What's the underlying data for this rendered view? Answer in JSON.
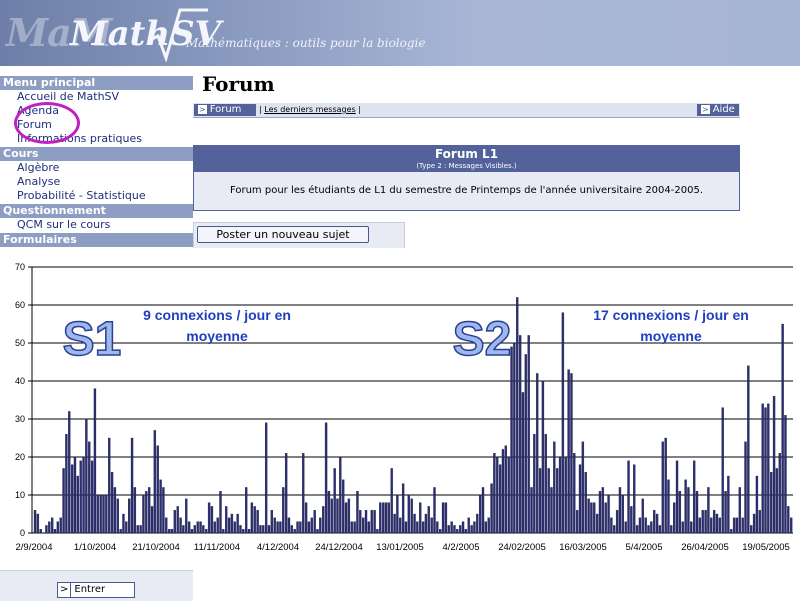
{
  "banner": {
    "ghost_text": "MaM",
    "logo": "MathSV",
    "tagline": "Mathématiques : outils pour la biologie"
  },
  "sidebar": {
    "sections": [
      {
        "title": "Menu principal",
        "items": [
          "Accueil de MathSV",
          "Agenda",
          "Forum",
          "Informations pratiques"
        ]
      },
      {
        "title": "Cours",
        "items": [
          "Algèbre",
          "Analyse",
          "Probabilité - Statistique"
        ]
      },
      {
        "title": "Questionnement",
        "items": [
          "QCM sur le cours"
        ]
      },
      {
        "title": "Formulaires",
        "items": []
      }
    ]
  },
  "forum": {
    "title": "Forum",
    "tab_forum": "Forum",
    "latest_messages": "Les derniers messages",
    "tab_help": "Aide",
    "box_title": "Forum L1",
    "box_subtitle": "(Type 2 : Messages Visibles.)",
    "box_description": "Forum pour les étudiants de L1 du semestre de Printemps de l'année universitaire 2004-2005.",
    "new_topic_button": "Poster un nouveau sujet"
  },
  "footer": {
    "enter_button": "Entrer"
  },
  "colors": {
    "bar_fill": "#2b2f6e",
    "annotation": "#1f3fbf",
    "header": "#53629a",
    "highlight_circle": "#c020c0"
  },
  "chart_data": {
    "type": "bar",
    "title": "",
    "xlabel": "",
    "ylabel": "",
    "ylim": [
      0,
      70
    ],
    "yticks": [
      0,
      10,
      20,
      30,
      40,
      50,
      60,
      70
    ],
    "grid": true,
    "x_tick_labels": [
      "2/9/2004",
      "1/10/2004",
      "21/10/2004",
      "11/11/2004",
      "4/12/2004",
      "24/12/2004",
      "13/01/2005",
      "4/2/2005",
      "24/02/2005",
      "16/03/2005",
      "5/4/2005",
      "26/04/2005",
      "19/05/2005"
    ],
    "annotations": [
      {
        "label": "S1",
        "text_line1": "9 connexions / jour en",
        "text_line2": "moyenne"
      },
      {
        "label": "S2",
        "text_line1": "17 connexions / jour en",
        "text_line2": "moyenne"
      }
    ],
    "series": [
      {
        "values": [
          6,
          5,
          1,
          0,
          2,
          3,
          4,
          1,
          3,
          4,
          17,
          26,
          32,
          18,
          20,
          15,
          19,
          20,
          30,
          24,
          19,
          38,
          10,
          10,
          10,
          10,
          25,
          16,
          12,
          9,
          1,
          5,
          3,
          9,
          25,
          12,
          2,
          2,
          10,
          11,
          12,
          7,
          27,
          23,
          14,
          12,
          4,
          1,
          1,
          6,
          7,
          4,
          2,
          9,
          3,
          1,
          2,
          3,
          3,
          2,
          1,
          8,
          7,
          3,
          4,
          11,
          1,
          7,
          4,
          5,
          3,
          5,
          2,
          1,
          12,
          1,
          8,
          7,
          6,
          2,
          2,
          29,
          2,
          6,
          4,
          3,
          3,
          12,
          21,
          4,
          2,
          1,
          3,
          3,
          21,
          8,
          3,
          4,
          6,
          1,
          4,
          7,
          29,
          11,
          9,
          17,
          9,
          20,
          14,
          8,
          9,
          3,
          3,
          11,
          6,
          4,
          6,
          3,
          6,
          6,
          1,
          8,
          8,
          8,
          8,
          17,
          5,
          10,
          4,
          13,
          3,
          10,
          9,
          5,
          3,
          8,
          3,
          5,
          7,
          4,
          12,
          3,
          1,
          8,
          8,
          2,
          3,
          2,
          1,
          2,
          3,
          1,
          4,
          2,
          3,
          5,
          10,
          12,
          3,
          4,
          13,
          21,
          20,
          18,
          22,
          23,
          20,
          49,
          50,
          62,
          52,
          37,
          47,
          52,
          12,
          26,
          42,
          17,
          40,
          26,
          17,
          12,
          24,
          17,
          20,
          58,
          20,
          43,
          42,
          21,
          6,
          18,
          24,
          16,
          9,
          8,
          8,
          5,
          11,
          12,
          8,
          10,
          4,
          2,
          6,
          12,
          10,
          3,
          19,
          7,
          18,
          2,
          4,
          9,
          4,
          2,
          3,
          6,
          5,
          2,
          24,
          25,
          14,
          2,
          8,
          19,
          11,
          3,
          14,
          12,
          3,
          19,
          11,
          4,
          6,
          6,
          12,
          4,
          6,
          5,
          4,
          33,
          11,
          15,
          1,
          4,
          4,
          12,
          4,
          24,
          44,
          2,
          5,
          15,
          6,
          34,
          33,
          34,
          16,
          36,
          17,
          21,
          55,
          31,
          7,
          4
        ]
      }
    ]
  }
}
